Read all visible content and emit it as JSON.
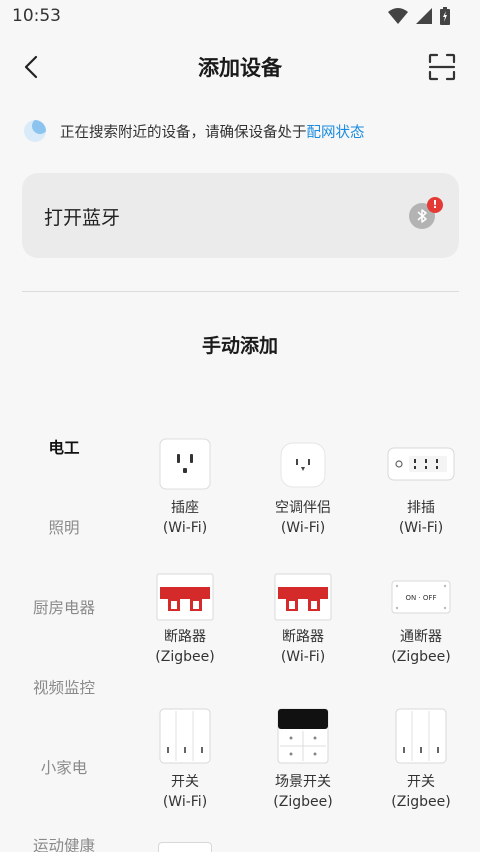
{
  "status_bar": {
    "time": "10:53"
  },
  "header": {
    "title": "添加设备"
  },
  "hint": {
    "text": "正在搜索附近的设备，请确保设备处于",
    "link": "配网状态"
  },
  "bluetooth": {
    "label": "打开蓝牙",
    "badge": "!"
  },
  "section": {
    "title": "手动添加"
  },
  "categories": [
    {
      "label": "电工",
      "active": true
    },
    {
      "label": "照明",
      "active": false
    },
    {
      "label": "厨房电器",
      "active": false
    },
    {
      "label": "视频监控",
      "active": false
    },
    {
      "label": "小家电",
      "active": false
    },
    {
      "label": "运动健康",
      "active": false
    }
  ],
  "devices": [
    {
      "name": "插座",
      "protocol": "(Wi-Fi)",
      "icon": "wall-socket-icon"
    },
    {
      "name": "空调伴侣",
      "protocol": "(Wi-Fi)",
      "icon": "ac-companion-icon"
    },
    {
      "name": "排插",
      "protocol": "(Wi-Fi)",
      "icon": "power-strip-icon"
    },
    {
      "name": "断路器",
      "protocol": "(Zigbee)",
      "icon": "circuit-breaker-icon"
    },
    {
      "name": "断路器",
      "protocol": "(Wi-Fi)",
      "icon": "circuit-breaker-icon"
    },
    {
      "name": "通断器",
      "protocol": "(Zigbee)",
      "icon": "on-off-module-icon",
      "icon_text": "ON · OFF"
    },
    {
      "name": "开关",
      "protocol": "(Wi-Fi)",
      "icon": "wall-switch-icon"
    },
    {
      "name": "场景开关",
      "protocol": "(Zigbee)",
      "icon": "scene-switch-icon"
    },
    {
      "name": "开关",
      "protocol": "(Zigbee)",
      "icon": "wall-switch-icon"
    }
  ],
  "colors": {
    "link": "#1a8ce0",
    "badge": "#e53935",
    "breaker_red": "#d42a2a"
  }
}
